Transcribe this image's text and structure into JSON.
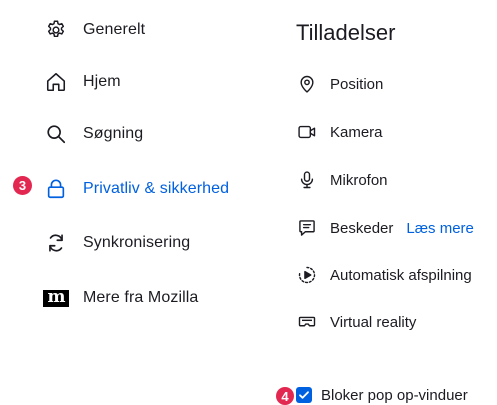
{
  "sidebar": {
    "items": [
      {
        "label": "Generelt",
        "icon": "gear-icon"
      },
      {
        "label": "Hjem",
        "icon": "home-icon"
      },
      {
        "label": "Søgning",
        "icon": "search-icon"
      },
      {
        "label": "Privatliv & sikkerhed",
        "icon": "lock-icon",
        "selected": true,
        "badge": "3"
      },
      {
        "label": "Synkronisering",
        "icon": "sync-icon"
      },
      {
        "label": "Mere fra Mozilla",
        "icon": "mozilla-logo-icon",
        "logo_text": "m"
      }
    ]
  },
  "permissions": {
    "title": "Tilladelser",
    "items": [
      {
        "label": "Position",
        "icon": "location-icon"
      },
      {
        "label": "Kamera",
        "icon": "camera-icon"
      },
      {
        "label": "Mikrofon",
        "icon": "microphone-icon"
      },
      {
        "label": "Beskeder",
        "icon": "notification-icon",
        "link": "Læs mere"
      },
      {
        "label": "Automatisk afspilning",
        "icon": "autoplay-icon"
      },
      {
        "label": "Virtual reality",
        "icon": "vr-headset-icon"
      }
    ],
    "block_popups": {
      "label": "Bloker pop op-vinduer",
      "checked": true,
      "badge": "4"
    }
  },
  "colors": {
    "accent": "#0061e0",
    "badge": "#e22850",
    "text": "#1c1b22"
  }
}
